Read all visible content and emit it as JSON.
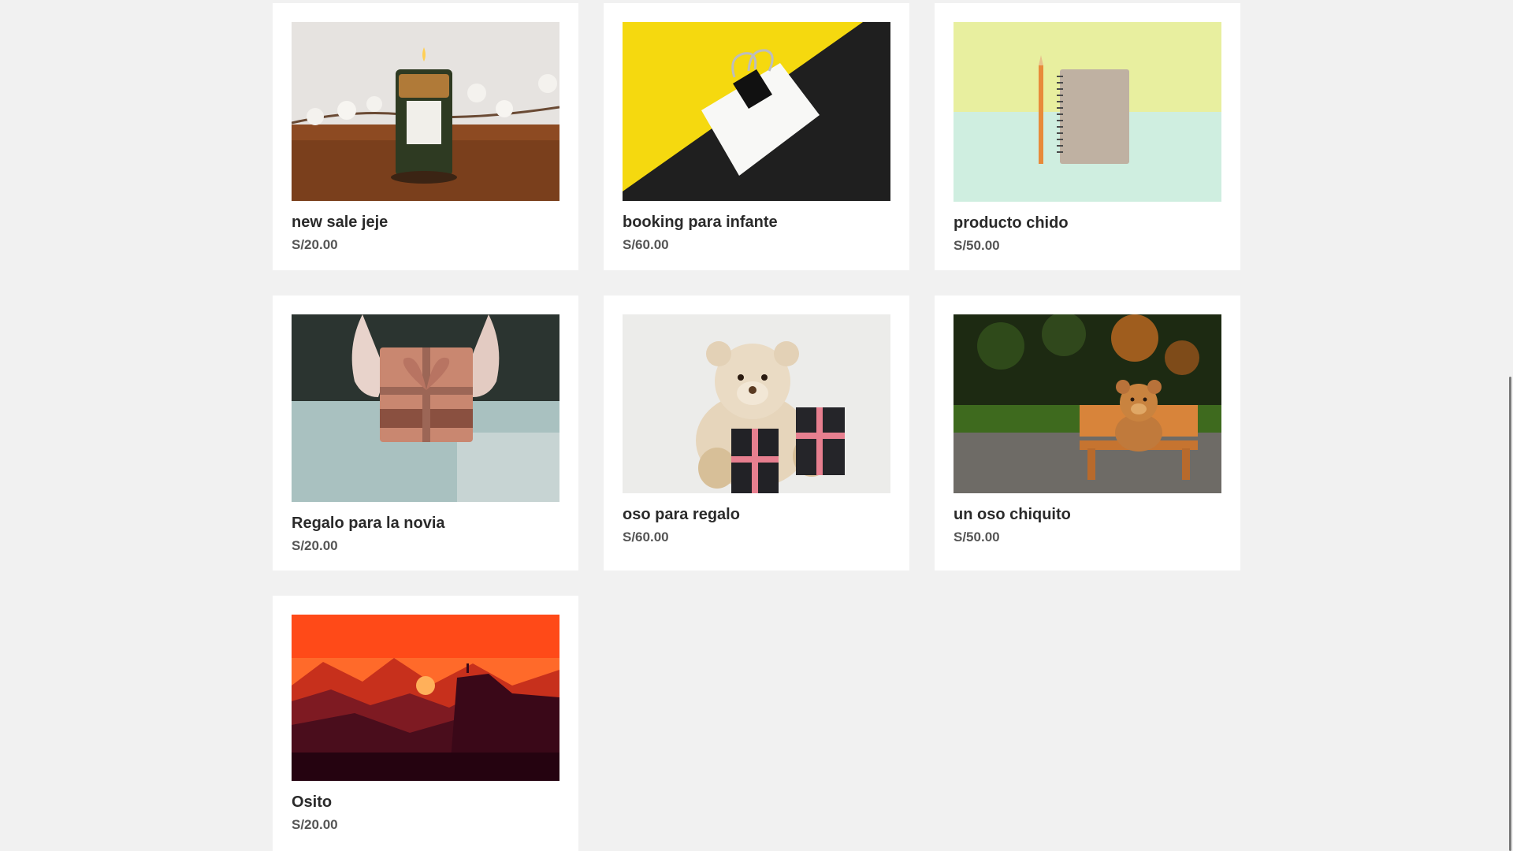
{
  "products": [
    {
      "name": "new sale jeje",
      "price": "S/20.00",
      "image": "candle-photo"
    },
    {
      "name": "booking para infante",
      "price": "S/60.00",
      "image": "binder-clip-card-photo"
    },
    {
      "name": "producto chido",
      "price": "S/50.00",
      "image": "notebook-pencil-photo"
    },
    {
      "name": "Regalo para la novia",
      "price": "S/20.00",
      "image": "gift-box-hands-photo"
    },
    {
      "name": "oso para regalo",
      "price": "S/60.00",
      "image": "teddy-bear-gifts-photo"
    },
    {
      "name": "un oso chiquito",
      "price": "S/50.00",
      "image": "teddy-bear-bench-photo"
    },
    {
      "name": "Osito",
      "price": "S/20.00",
      "image": "sunset-landscape-illustration"
    }
  ]
}
